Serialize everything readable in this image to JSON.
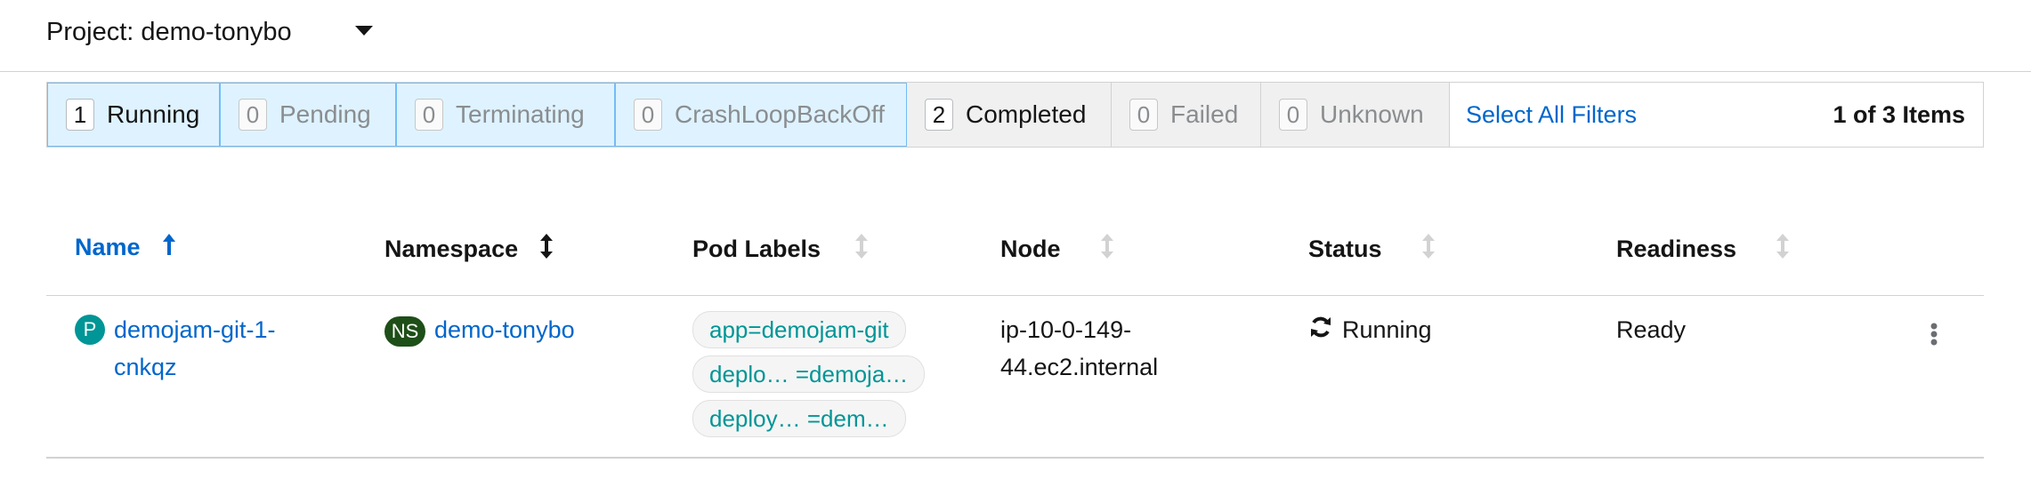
{
  "project": {
    "label": "Project: demo-tonybo"
  },
  "filters": [
    {
      "count": "1",
      "label": "Running",
      "active": true
    },
    {
      "count": "0",
      "label": "Pending",
      "active": true
    },
    {
      "count": "0",
      "label": "Terminating",
      "active": true
    },
    {
      "count": "0",
      "label": "CrashLoopBackOff",
      "active": true
    },
    {
      "count": "2",
      "label": "Completed",
      "active": false
    },
    {
      "count": "0",
      "label": "Failed",
      "active": false
    },
    {
      "count": "0",
      "label": "Unknown",
      "active": false
    }
  ],
  "select_all_label": "Select All Filters",
  "items_count": "1 of 3 Items",
  "columns": {
    "name": "Name",
    "namespace": "Namespace",
    "pod_labels": "Pod Labels",
    "node": "Node",
    "status": "Status",
    "readiness": "Readiness"
  },
  "rows": [
    {
      "resource_badge": "P",
      "name_line1": "demojam-git-1-",
      "name_line2": "cnkqz",
      "namespace_badge": "NS",
      "namespace": "demo-tonybo",
      "labels": [
        "app=demojam-git",
        "deplo…  =demoja…",
        "deploy…   =dem…"
      ],
      "node_line1": "ip-10-0-149-",
      "node_line2": "44.ec2.internal",
      "status": "Running",
      "readiness": "Ready"
    }
  ],
  "colors": {
    "link": "#0066cc",
    "active_filter_bg": "#def3ff",
    "chip_text": "#009596",
    "ns_badge": "#1e4f18"
  }
}
